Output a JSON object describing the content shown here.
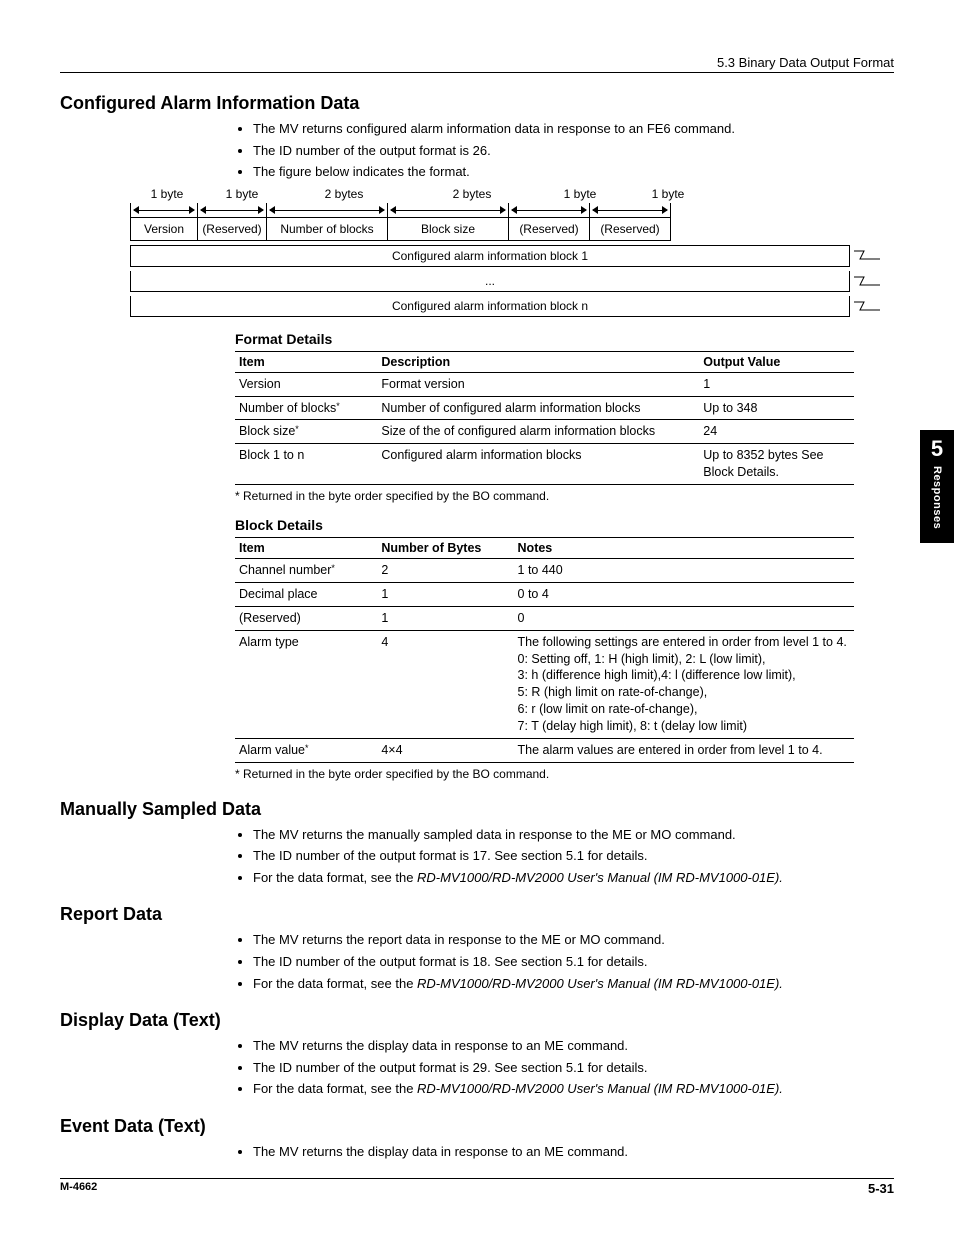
{
  "header": {
    "section": "5.3  Binary Data Output Format"
  },
  "tab": {
    "number": "5",
    "label": "Responses"
  },
  "s1": {
    "title": "Configured Alarm Information Data",
    "b1": "The MV returns configured alarm information data in response to an FE6 command.",
    "b2": "The ID number of the output format is 26.",
    "b3": "The figure below indicates the format."
  },
  "diagram": {
    "sz1": "1 byte",
    "sz2": "1 byte",
    "sz3": "2 bytes",
    "sz4": "2 bytes",
    "sz5": "1 byte",
    "sz6": "1 byte",
    "c1": "Version",
    "c2": "(Reserved)",
    "c3": "Number of blocks",
    "c4": "Block size",
    "c5": "(Reserved)",
    "c6": "(Reserved)",
    "row1": "Configured alarm information block 1",
    "rowdots": "...",
    "rown": "Configured alarm information block n"
  },
  "fmt": {
    "title": "Format Details",
    "th1": "Item",
    "th2": "Description",
    "th3": "Output Value",
    "r1a": "Version",
    "r1b": "Format version",
    "r1c": "1",
    "r2a": "Number of blocks",
    "r2b": "Number of configured alarm information blocks",
    "r2c": "Up to 348",
    "r3a": "Block size",
    "r3b": "Size of the of configured alarm information blocks",
    "r3c": "24",
    "r4a": "Block 1 to n",
    "r4b": "Configured alarm information blocks",
    "r4c": "Up to 8352 bytes See Block Details.",
    "note": "* Returned in the byte order specified by the BO command."
  },
  "blk": {
    "title": "Block Details",
    "th1": "Item",
    "th2": "Number of Bytes",
    "th3": "Notes",
    "r1a": "Channel number",
    "r1b": "2",
    "r1c": "1 to 440",
    "r2a": "Decimal place",
    "r2b": "1",
    "r2c": "0 to 4",
    "r3a": "(Reserved)",
    "r3b": "1",
    "r3c": "0",
    "r4a": "Alarm type",
    "r4b": "4",
    "r4c_l1": "The following settings are entered in order from level 1 to 4.",
    "r4c_l2": "0: Setting off, 1: H (high limit), 2: L (low limit),",
    "r4c_l3": "3: h (difference high limit),4: l (difference low limit),",
    "r4c_l4": "5: R (high limit on rate-of-change),",
    "r4c_l5": "6: r (low limit on rate-of-change),",
    "r4c_l6": "7: T (delay high limit), 8: t (delay low limit)",
    "r5a": "Alarm value",
    "r5b": "4×4",
    "r5c": "The alarm values are entered in order from level 1 to 4.",
    "note": "* Returned in the byte order specified by the BO command."
  },
  "s2": {
    "title": "Manually Sampled Data",
    "b1": "The MV returns the manually sampled data in response to the ME or MO command.",
    "b2": "The ID number of the output format is 17. See section 5.1 for details.",
    "b3a": "For the data format, see the ",
    "b3b": "RD-MV1000/RD-MV2000 User's Manual (IM RD-MV1000-01E)."
  },
  "s3": {
    "title": "Report Data",
    "b1": "The MV returns the report data in response to the ME or MO command.",
    "b2": "The ID number of the output format is 18. See section 5.1 for details.",
    "b3a": "For the data format, see the ",
    "b3b": "RD-MV1000/RD-MV2000 User's Manual (IM RD-MV1000-01E)."
  },
  "s4": {
    "title": "Display Data (Text)",
    "b1": "The MV returns the display data in response to an ME command.",
    "b2": "The ID number of the output format is 29. See section 5.1 for details.",
    "b3a": "For the data format, see the ",
    "b3b": "RD-MV1000/RD-MV2000 User's Manual (IM RD-MV1000-01E)."
  },
  "s5": {
    "title": "Event Data (Text)",
    "b1": "The MV returns the display data in response to an ME command."
  },
  "footer": {
    "left": "M-4662",
    "right": "5-31"
  }
}
